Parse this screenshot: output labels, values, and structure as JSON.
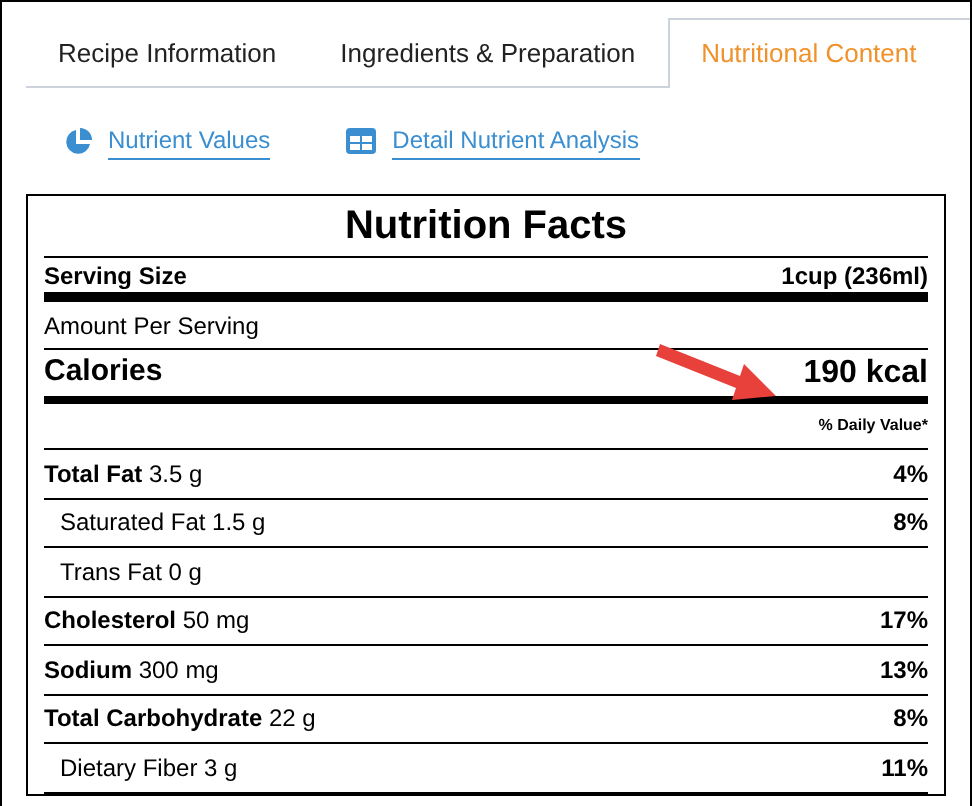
{
  "tabs": [
    {
      "label": "Recipe Information",
      "selected": false
    },
    {
      "label": "Ingredients & Preparation",
      "selected": false
    },
    {
      "label": "Nutritional Content",
      "selected": true
    }
  ],
  "links": [
    {
      "label": "Nutrient Values",
      "kind": "pie"
    },
    {
      "label": "Detail Nutrient Analysis",
      "kind": "table"
    }
  ],
  "facts": {
    "title": "Nutrition Facts",
    "serving_label": "Serving Size",
    "serving_value": "1cup (236ml)",
    "amount_label": "Amount Per Serving",
    "calories_label": "Calories",
    "calories_value": "190 kcal",
    "daily_value_label": "% Daily Value*",
    "rows": [
      {
        "label": "**Total Fat** 3.5 g",
        "value": "4%",
        "kind": "main"
      },
      {
        "label": "Saturated Fat 1.5 g",
        "value": "8%",
        "kind": "sub"
      },
      {
        "label": "Trans Fat 0 g",
        "kind": "sub"
      },
      {
        "label": "**Cholesterol** 50 mg",
        "value": "17%",
        "kind": "main"
      },
      {
        "label": "**Sodium** 300 mg",
        "value": "13%",
        "kind": "main"
      },
      {
        "label": "**Total Carbohydrate** 22 g",
        "value": "8%",
        "kind": "main"
      },
      {
        "label": "Dietary Fiber 3 g",
        "value": "11%",
        "kind": "sub"
      }
    ]
  }
}
